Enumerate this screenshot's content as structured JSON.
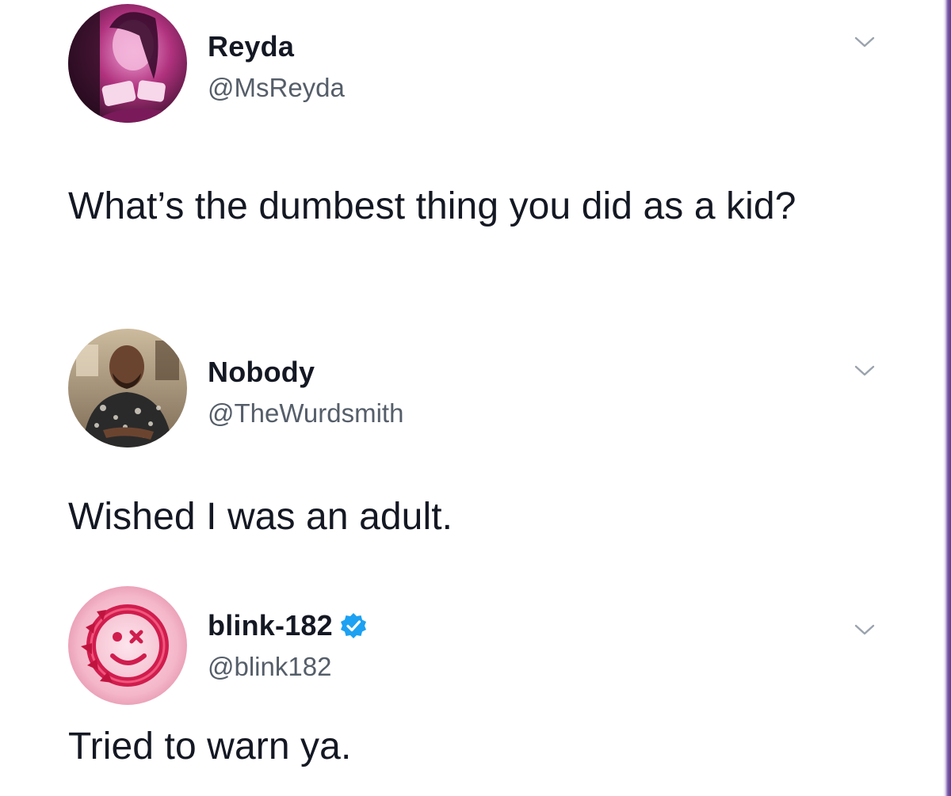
{
  "tweets": [
    {
      "display_name": "Reyda",
      "handle": "@MsReyda",
      "text": "What’s the dumbest thing you did as a kid?",
      "verified": false,
      "avatar": "user-photo-pink-avatar"
    },
    {
      "display_name": "Nobody",
      "handle": "@TheWurdsmith",
      "text": "Wished I was an adult.",
      "verified": false,
      "avatar": "user-photo-man-avatar"
    },
    {
      "display_name": "blink-182",
      "handle": "@blink182",
      "text": "Tried to warn ya.",
      "verified": true,
      "avatar": "smiley-logo-avatar"
    }
  ],
  "colors": {
    "text_primary": "#141823",
    "text_secondary": "#555e69",
    "verified_blue": "#1da1f2",
    "chevron": "#9aa3ad",
    "frame_purple": "#5b3c8c"
  },
  "icons": {
    "menu": "chevron-down-icon",
    "verified": "verified-badge-icon"
  }
}
